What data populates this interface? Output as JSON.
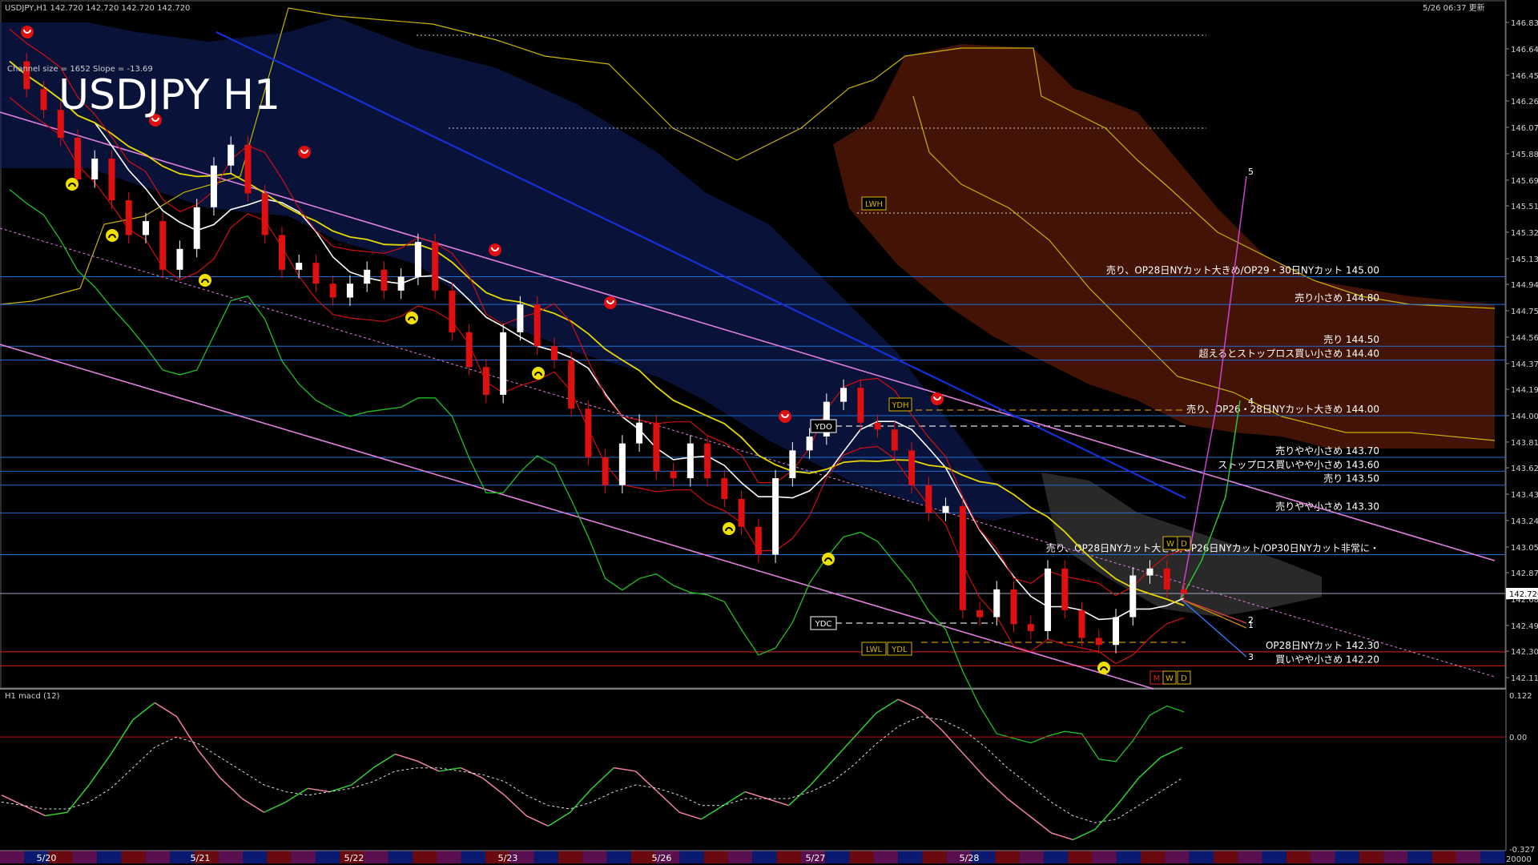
{
  "header": {
    "symbol_info": "USDJPY,H1  142.720 142.720 142.720 142.720",
    "timestamp": "5/26 06:37 更新",
    "channel_info": "Channel size = 1652 Slope = -13.69",
    "big_title": "USDJPY H1"
  },
  "chart_data": {
    "type": "line",
    "title": "USDJPY H1",
    "price_axis": {
      "ylim": [
        142.115,
        146.83
      ],
      "ticks": [
        "146.830",
        "146.640",
        "146.450",
        "146.265",
        "146.075",
        "145.885",
        "145.695",
        "145.510",
        "145.320",
        "145.130",
        "144.945",
        "144.755",
        "144.565",
        "144.375",
        "144.190",
        "144.000",
        "143.810",
        "143.625",
        "143.435",
        "143.245",
        "143.055",
        "142.870",
        "142.680",
        "142.490",
        "142.305",
        "142.115"
      ],
      "current_price": "142.720"
    },
    "x_labels": [
      "5/20",
      "5/21",
      "5/22",
      "5/23",
      "5/26",
      "5/27",
      "5/28"
    ],
    "price_series": [
      146.55,
      146.35,
      146.2,
      146.0,
      145.7,
      145.85,
      145.55,
      145.3,
      145.4,
      145.05,
      145.2,
      145.5,
      145.8,
      145.95,
      145.6,
      145.3,
      145.05,
      145.1,
      144.95,
      144.85,
      144.95,
      145.05,
      144.9,
      145.0,
      145.25,
      144.9,
      144.6,
      144.35,
      144.15,
      144.6,
      144.8,
      144.5,
      144.4,
      144.05,
      143.7,
      143.5,
      143.8,
      143.95,
      143.6,
      143.55,
      143.8,
      143.55,
      143.4,
      143.2,
      143.0,
      143.55,
      143.75,
      143.85,
      144.1,
      144.2,
      143.95,
      143.9,
      143.75,
      143.5,
      143.3,
      143.35,
      142.6,
      142.55,
      142.75,
      142.5,
      142.45,
      142.9,
      142.6,
      142.4,
      142.35,
      142.55,
      142.85,
      142.9,
      142.75,
      142.72
    ],
    "levels": [
      {
        "label": "売り、OP28日NYカット大きめ/OP29・30日NYカット 145.00",
        "price": 145.0,
        "color": "#1f6fd1"
      },
      {
        "label": "売り小さめ 144.80",
        "price": 144.8,
        "color": "#1f6fd1"
      },
      {
        "label": "売り 144.50",
        "price": 144.5,
        "color": "#1f6fd1"
      },
      {
        "label": "超えるとストップロス買い小さめ 144.40",
        "price": 144.4,
        "color": "#1f6fd1"
      },
      {
        "label": "売り、OP26・28日NYカット大きめ 144.00",
        "price": 144.0,
        "color": "#1f6fd1"
      },
      {
        "label": "売りやや小さめ 143.70",
        "price": 143.7,
        "color": "#1f6fd1"
      },
      {
        "label": "ストップロス買いやや小さめ 143.60",
        "price": 143.6,
        "color": "#1f6fd1"
      },
      {
        "label": "売り 143.50",
        "price": 143.5,
        "color": "#1f6fd1"
      },
      {
        "label": "売りやや小さめ 143.30",
        "price": 143.3,
        "color": "#1f6fd1"
      },
      {
        "label": "売り、OP28日NYカット大きめ/OP26日NYカット/OP30日NYカット非常に・",
        "price": 143.0,
        "color": "#1f6fd1"
      },
      {
        "label": "",
        "price": 142.72,
        "color": "#9aa6c0"
      },
      {
        "label": "OP28日NYカット 142.30",
        "price": 142.3,
        "color": "#e02020"
      },
      {
        "label": "買いやや小さめ 142.20",
        "price": 142.2,
        "color": "#e02020"
      }
    ],
    "markers": {
      "ydh": "YDH",
      "ydo": "YDO",
      "ydc": "YDC",
      "ydl": "YDL",
      "lwl": "LWL",
      "lwh": "LWH",
      "w": "W",
      "d": "D",
      "m": "M"
    },
    "projection_labels": [
      "5",
      "4",
      "2",
      "1",
      "3"
    ],
    "macd": {
      "label": "H1  macd (12)",
      "ylim": [
        -0.327,
        0.122
      ],
      "ticks": [
        "0.122",
        "0.00",
        "-0.327"
      ],
      "bottom_label": "20000",
      "main": [
        -0.17,
        -0.2,
        -0.23,
        -0.22,
        -0.14,
        -0.05,
        0.05,
        0.1,
        0.06,
        -0.04,
        -0.12,
        -0.18,
        -0.22,
        -0.19,
        -0.15,
        -0.16,
        -0.14,
        -0.09,
        -0.05,
        -0.07,
        -0.1,
        -0.09,
        -0.12,
        -0.17,
        -0.23,
        -0.26,
        -0.22,
        -0.15,
        -0.09,
        -0.1,
        -0.16,
        -0.22,
        -0.24,
        -0.2,
        -0.16,
        -0.18,
        -0.2,
        -0.14,
        -0.07,
        0.0,
        0.07,
        0.11,
        0.08,
        0.02,
        -0.05,
        -0.12,
        -0.18,
        -0.23,
        -0.28,
        -0.3,
        -0.27,
        -0.2,
        -0.12,
        -0.06,
        -0.03
      ],
      "signal": [
        -0.19,
        -0.2,
        -0.21,
        -0.21,
        -0.19,
        -0.15,
        -0.09,
        -0.03,
        0.0,
        -0.02,
        -0.06,
        -0.1,
        -0.14,
        -0.16,
        -0.17,
        -0.16,
        -0.15,
        -0.13,
        -0.1,
        -0.09,
        -0.09,
        -0.1,
        -0.11,
        -0.13,
        -0.17,
        -0.2,
        -0.21,
        -0.19,
        -0.16,
        -0.14,
        -0.15,
        -0.17,
        -0.2,
        -0.2,
        -0.18,
        -0.18,
        -0.18,
        -0.16,
        -0.13,
        -0.08,
        -0.02,
        0.03,
        0.06,
        0.05,
        0.02,
        -0.03,
        -0.09,
        -0.14,
        -0.19,
        -0.23,
        -0.25,
        -0.24,
        -0.2,
        -0.16,
        -0.12
      ]
    }
  }
}
